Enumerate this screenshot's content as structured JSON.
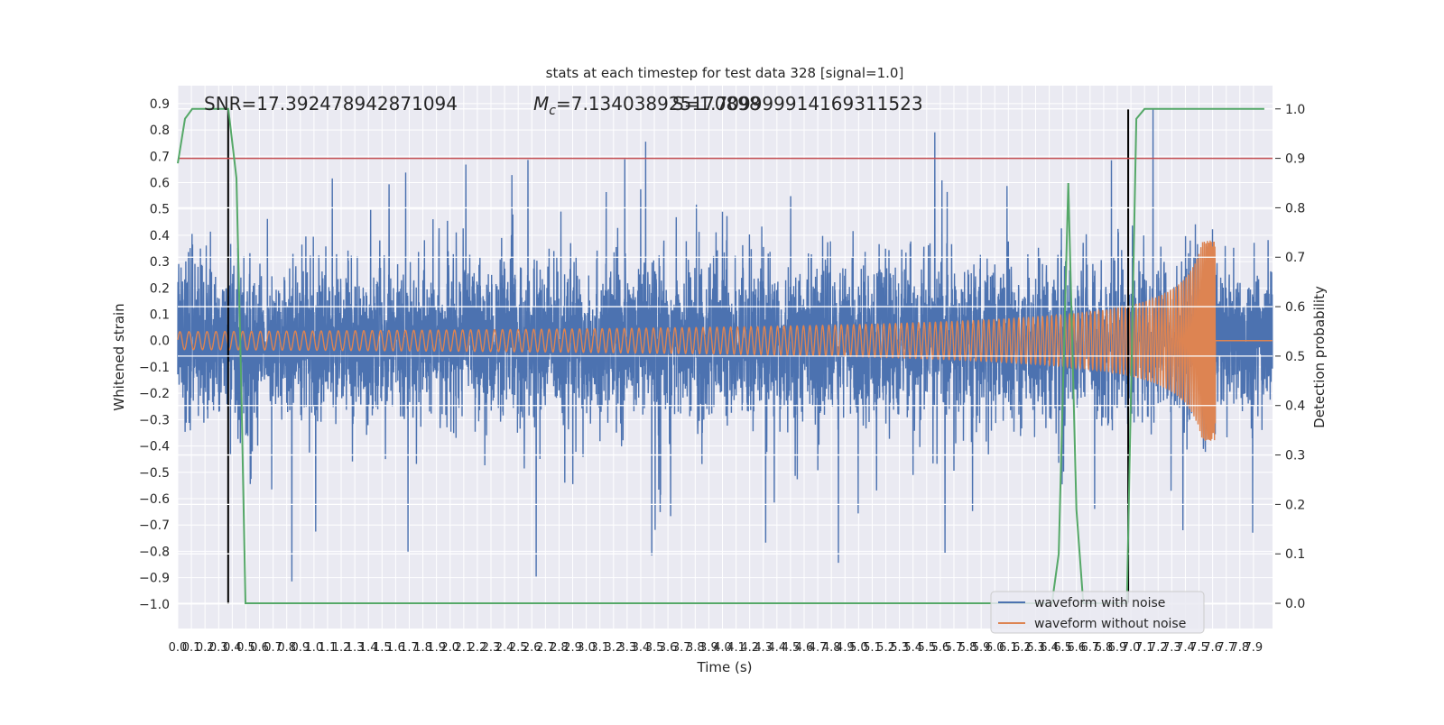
{
  "chart_data": {
    "type": "line",
    "title": "stats at each timestep for test data 328 [signal=1.0]",
    "annotations": {
      "snr": "SNR=17.392478942871094",
      "mc_symbol": "M",
      "mc_sub": "c",
      "mc_value": "=7.134038925170898",
      "overlap_value": "S=1.709999914169311523"
    },
    "xlabel": "Time (s)",
    "ylabel_left": "Whitened strain",
    "ylabel_right": "Detection probability",
    "xlim": [
      0.0,
      8.04
    ],
    "ylim_left": [
      -1.093,
      0.968
    ],
    "ylim_right": [
      -0.051,
      1.047
    ],
    "xticks": [
      "0.0",
      "0.1",
      "0.2",
      "0.3",
      "0.4",
      "0.5",
      "0.6",
      "0.7",
      "0.8",
      "0.9",
      "1.0",
      "1.1",
      "1.2",
      "1.3",
      "1.4",
      "1.5",
      "1.6",
      "1.7",
      "1.8",
      "1.9",
      "2.0",
      "2.1",
      "2.2",
      "2.3",
      "2.4",
      "2.5",
      "2.6",
      "2.7",
      "2.8",
      "2.9",
      "3.0",
      "3.1",
      "3.2",
      "3.3",
      "3.4",
      "3.5",
      "3.6",
      "3.7",
      "3.8",
      "3.9",
      "4.0",
      "4.1",
      "4.2",
      "4.3",
      "4.4",
      "4.5",
      "4.6",
      "4.7",
      "4.8",
      "4.9",
      "5.0",
      "5.1",
      "5.2",
      "5.3",
      "5.4",
      "5.5",
      "5.6",
      "5.7",
      "5.8",
      "5.9",
      "6.0",
      "6.1",
      "6.2",
      "6.3",
      "6.4",
      "6.5",
      "6.6",
      "6.7",
      "6.8",
      "6.9",
      "7.0",
      "7.1",
      "7.2",
      "7.3",
      "7.4",
      "7.5",
      "7.6",
      "7.7",
      "7.8",
      "7.9"
    ],
    "yticks_left": [
      "0.9",
      "0.8",
      "0.7",
      "0.6",
      "0.5",
      "0.4",
      "0.3",
      "0.2",
      "0.1",
      "0.0",
      "−0.1",
      "−0.2",
      "−0.3",
      "−0.4",
      "−0.5",
      "−0.6",
      "−0.7",
      "−0.8",
      "−0.9",
      "−1.0"
    ],
    "yticks_right": [
      "1.0",
      "0.9",
      "0.8",
      "0.7",
      "0.6",
      "0.5",
      "0.4",
      "0.3",
      "0.2",
      "0.1",
      "0.0"
    ],
    "grid": true,
    "legend_position": "bottom-right",
    "series": [
      {
        "name": "waveform with noise",
        "color": "#4c72b0",
        "axis": "left",
        "description_kind": "noisy strain"
      },
      {
        "name": "waveform without noise",
        "color": "#dd8452",
        "axis": "left",
        "description_kind": "chirp",
        "merger_time": 7.62,
        "peak_amplitude": 0.38
      },
      {
        "color": "#55a868",
        "axis": "right",
        "x": [
          0.0,
          0.053,
          0.106,
          0.371,
          0.431,
          0.465,
          0.497,
          5.82,
          6.42,
          6.47,
          6.54,
          6.6,
          6.65,
          6.97,
          7.04,
          7.1,
          7.98
        ],
        "y": [
          0.89,
          0.98,
          1.0,
          1.0,
          0.86,
          0.45,
          0.0,
          0.0,
          0.0,
          0.1,
          0.85,
          0.19,
          0.0,
          0.0,
          0.98,
          1.0,
          1.0
        ]
      }
    ],
    "threshold": {
      "value": 0.9,
      "axis": "right",
      "color": "#c44e52"
    },
    "vlines": {
      "x": [
        0.37,
        6.98
      ],
      "color": "#000000"
    }
  }
}
